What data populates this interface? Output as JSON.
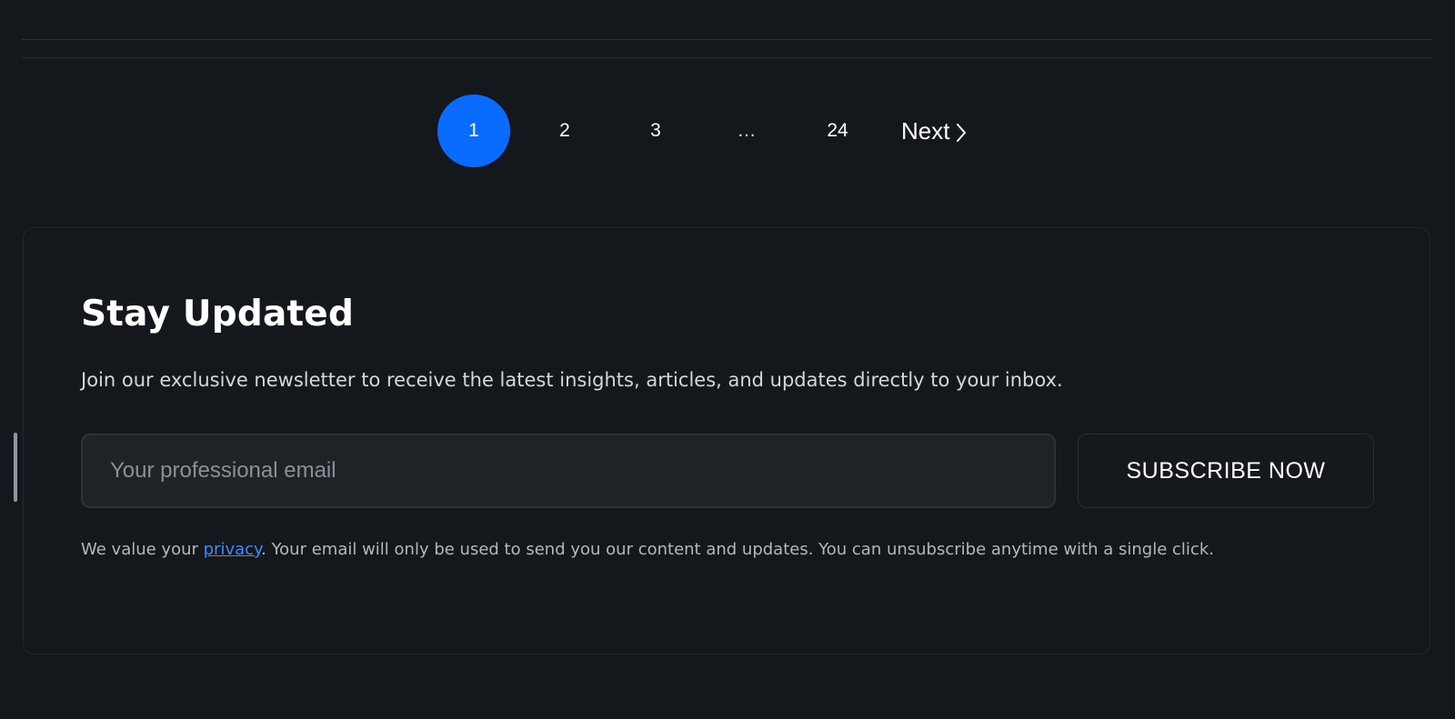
{
  "pagination": {
    "pages": [
      "1",
      "2",
      "3"
    ],
    "ellipsis": "…",
    "last_page": "24",
    "active_page": "1",
    "next_label": "Next",
    "next_icon": "chevron-right-icon",
    "active_color": "#0a6cff"
  },
  "newsletter": {
    "title": "Stay Updated",
    "description": "Join our exclusive newsletter to receive the latest insights, articles, and updates directly to your inbox.",
    "email_placeholder": "Your professional email",
    "email_value": "",
    "subscribe_label": "SUBSCRIBE NOW",
    "privacy": {
      "prefix": "We value your ",
      "link_text": "privacy",
      "suffix": ". Your email will only be used to send you our content and updates. You can unsubscribe anytime with a single click."
    }
  },
  "colors": {
    "background": "#14171b",
    "accent": "#0a6cff",
    "link": "#3d8bff"
  }
}
